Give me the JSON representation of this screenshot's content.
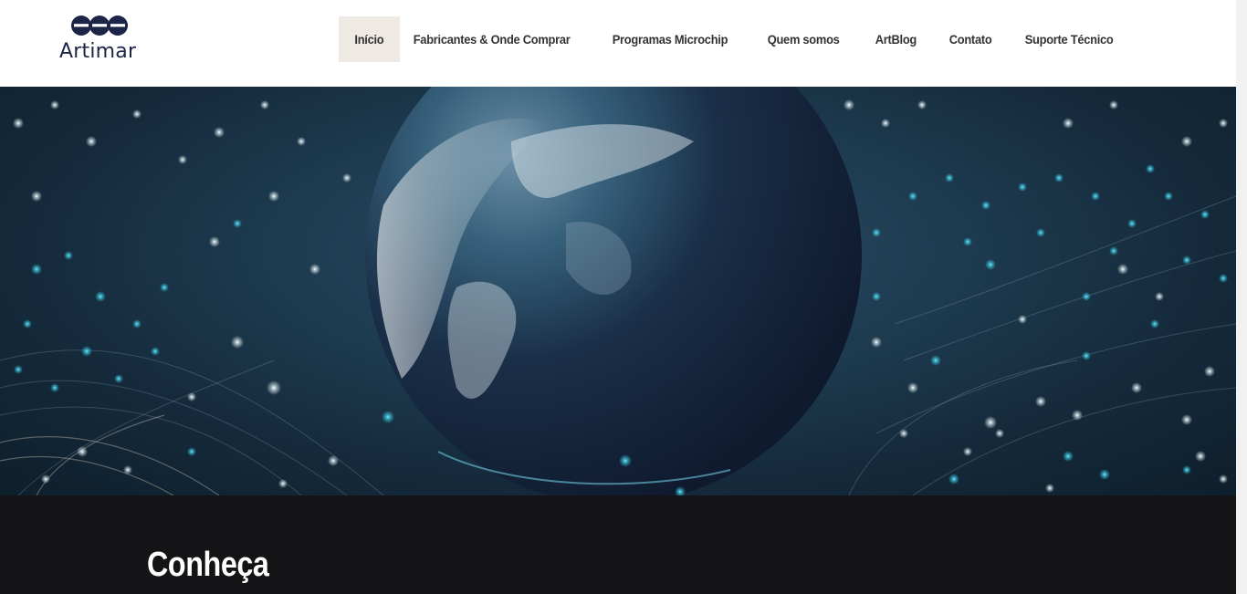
{
  "header": {
    "logo_text": "Artimar",
    "nav": [
      {
        "label": "Início",
        "active": true
      },
      {
        "label": "Fabricantes & Onde Comprar",
        "active": false
      },
      {
        "label": "Programas Microchip",
        "active": false
      },
      {
        "label": "Quem somos",
        "active": false
      },
      {
        "label": "ArtBlog",
        "active": false
      },
      {
        "label": "Contato",
        "active": false
      },
      {
        "label": "Suporte Técnico",
        "active": false
      }
    ]
  },
  "hero": {
    "image": "earth-globe-with-glowing-network-lights"
  },
  "section": {
    "title": "Conheça"
  },
  "colors": {
    "brand_navy": "#1c2447",
    "active_nav_bg": "#eee9e3",
    "dark_section_bg": "#141416",
    "glow_cyan": "#3fd8f0"
  }
}
